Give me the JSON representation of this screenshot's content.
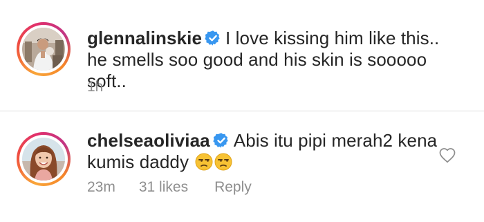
{
  "comments": [
    {
      "username": "glennalinskie",
      "verified": true,
      "text": "I love kissing him like this.. he smells soo good and his skin is sooooo soft..",
      "time": "1h"
    },
    {
      "username": "chelseaoliviaa",
      "verified": true,
      "text": "Abis itu pipi merah2 kena kumis daddy",
      "emoji": "😒😒",
      "time": "23m",
      "likes": "31 likes",
      "reply_label": "Reply"
    }
  ],
  "colors": {
    "verified_blue": "#3897f0",
    "meta_gray": "#8e8e8e",
    "text": "#262626",
    "divider": "#dbdbdb"
  },
  "icons": {
    "verified": "verified-badge-icon",
    "like": "heart-outline-icon",
    "emoji": "unamused-face-emoji"
  }
}
